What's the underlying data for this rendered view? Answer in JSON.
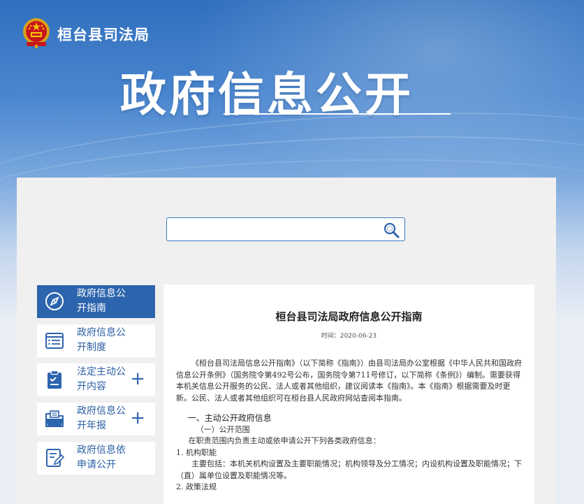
{
  "header": {
    "site_name": "桓台县司法局",
    "banner_title": "政府信息公开"
  },
  "search": {
    "value": "",
    "placeholder": ""
  },
  "sidebar": {
    "items": [
      {
        "label": "政府信息公开指南",
        "icon": "compass-icon",
        "active": true,
        "expandable": false
      },
      {
        "label": "政府信息公开制度",
        "icon": "document-list-icon",
        "active": false,
        "expandable": false
      },
      {
        "label": "法定主动公开内容",
        "icon": "clipboard-icon",
        "active": false,
        "expandable": true
      },
      {
        "label": "政府信息公开年报",
        "icon": "folder-icon",
        "active": false,
        "expandable": true
      },
      {
        "label": "政府信息依申请公开",
        "icon": "form-edit-icon",
        "active": false,
        "expandable": false
      }
    ],
    "expand_symbol": "+"
  },
  "article": {
    "title": "桓台县司法局政府信息公开指南",
    "time": "时间：2020-06-23",
    "intro": "《桓台县司法局信息公开指南》（以下简称《指南》）由县司法局办公室根据《中华人民共和国政府信息公开条例》（国务院令第492号公布，国务院令第711号修订，以下简称《条例》）编制。需要获得本机关信息公开服务的公民、法人或者其他组织，建议阅读本《指南》。本《指南》根据需要及时更新。公民、法人或者其他组织可在桓台县人民政府网站查阅本指南。",
    "section1": "一、主动公开政府信息",
    "section1_sub1": "（一）公开范围",
    "section1_sub1_text": "在职责范围内负责主动或依申请公开下列各类政府信息：",
    "item1": "1. 机构职能",
    "item1_text": "主要包括：本机关机构设置及主要职能情况；机构领导及分工情况；内设机构设置及职能情况；下（直）属单位设置及职能情况等。",
    "item2": "2. 政策法规"
  },
  "colors": {
    "primary": "#2c64ad",
    "panel_bg": "#f0f0f0",
    "banner_top": "#2f6fbe"
  }
}
